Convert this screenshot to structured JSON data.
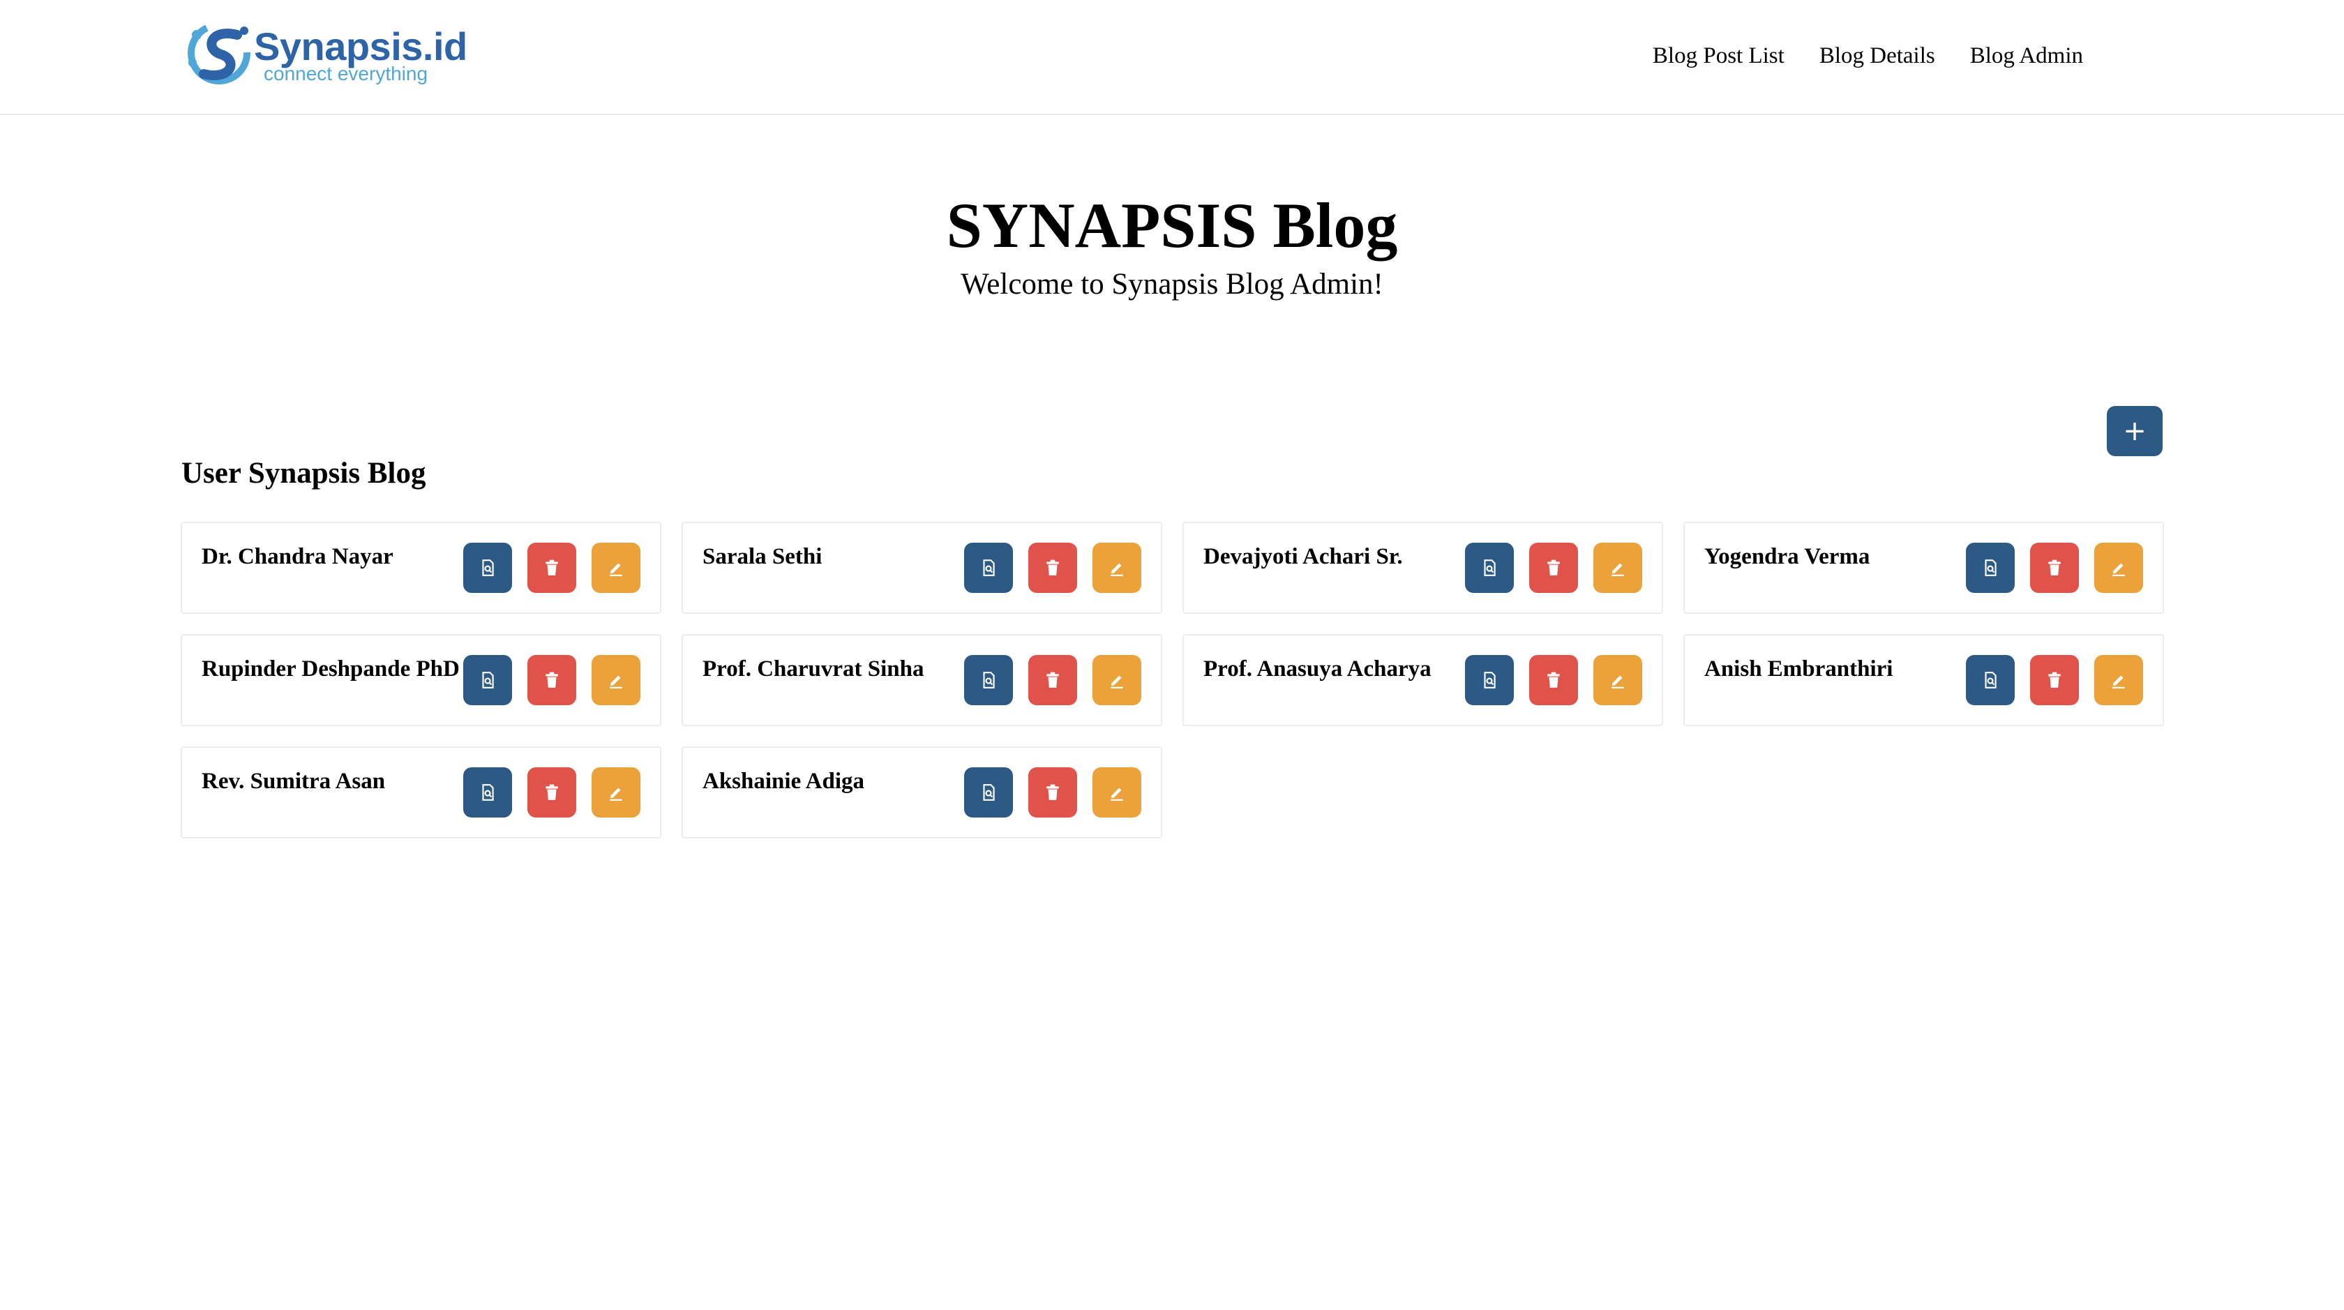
{
  "brand": {
    "name": "Synapsis.id",
    "tagline": "connect everything"
  },
  "nav": {
    "items": [
      "Blog Post List",
      "Blog Details",
      "Blog Admin"
    ]
  },
  "hero": {
    "title": "SYNAPSIS Blog",
    "subtitle": "Welcome to Synapsis Blog Admin!"
  },
  "toolbar": {
    "add_label": "+"
  },
  "section": {
    "title": "User Synapsis Blog"
  },
  "users": [
    {
      "name": "Dr. Chandra Nayar"
    },
    {
      "name": "Sarala Sethi"
    },
    {
      "name": "Devajyoti Achari Sr."
    },
    {
      "name": "Yogendra Verma"
    },
    {
      "name": "Rupinder Deshpande PhD"
    },
    {
      "name": "Prof. Charuvrat Sinha"
    },
    {
      "name": "Prof. Anasuya Acharya"
    },
    {
      "name": "Anish Embranthiri"
    },
    {
      "name": "Rev. Sumitra Asan"
    },
    {
      "name": "Akshainie Adiga"
    }
  ],
  "icons": {
    "view": "view-document-icon",
    "delete": "trash-icon",
    "edit": "pencil-icon",
    "add": "plus-icon"
  },
  "colors": {
    "primary": "#2c5a85",
    "danger": "#e0534b",
    "warning": "#eba23a"
  }
}
